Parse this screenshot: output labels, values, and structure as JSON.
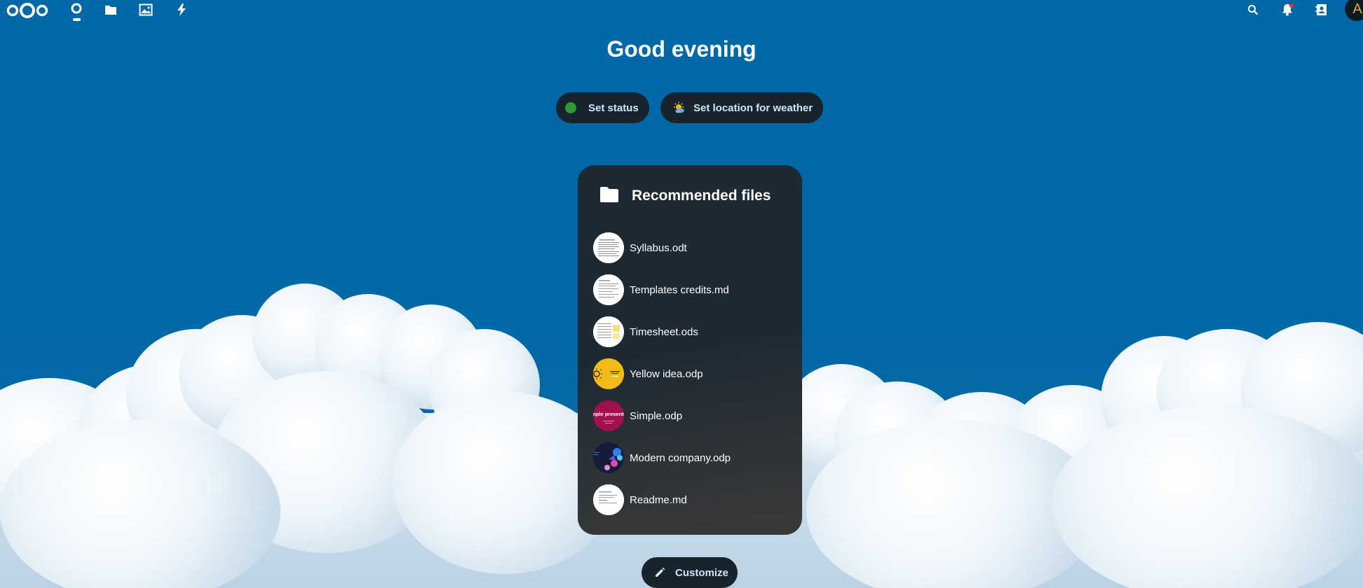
{
  "header": {
    "nav": [
      {
        "icon": "dashboard-icon",
        "active": true
      },
      {
        "icon": "files-icon"
      },
      {
        "icon": "photos-icon"
      },
      {
        "icon": "activity-icon"
      }
    ],
    "right_icons": [
      "search-icon",
      "notifications-icon",
      "contacts-icon"
    ],
    "avatar_initial": "A"
  },
  "greeting": "Good evening",
  "status_button": {
    "label": "Set status",
    "color": "#2e9a35"
  },
  "weather_button": {
    "label": "Set location for weather"
  },
  "recommended": {
    "title": "Recommended files",
    "files": [
      {
        "name": "Syllabus.odt",
        "thumb": "document"
      },
      {
        "name": "Templates credits.md",
        "thumb": "document"
      },
      {
        "name": "Timesheet.ods",
        "thumb": "spreadsheet"
      },
      {
        "name": "Yellow idea.odp",
        "thumb": "yellow-slide"
      },
      {
        "name": "Simple.odp",
        "thumb": "magenta-slide",
        "thumb_text": "mple presentati"
      },
      {
        "name": "Modern company.odp",
        "thumb": "dark-slide"
      },
      {
        "name": "Readme.md",
        "thumb": "document"
      }
    ]
  },
  "customize_button": {
    "label": "Customize"
  },
  "colors": {
    "background": "#0068a6",
    "pill": "#17242e",
    "accent_text": "#cfe6f7"
  }
}
